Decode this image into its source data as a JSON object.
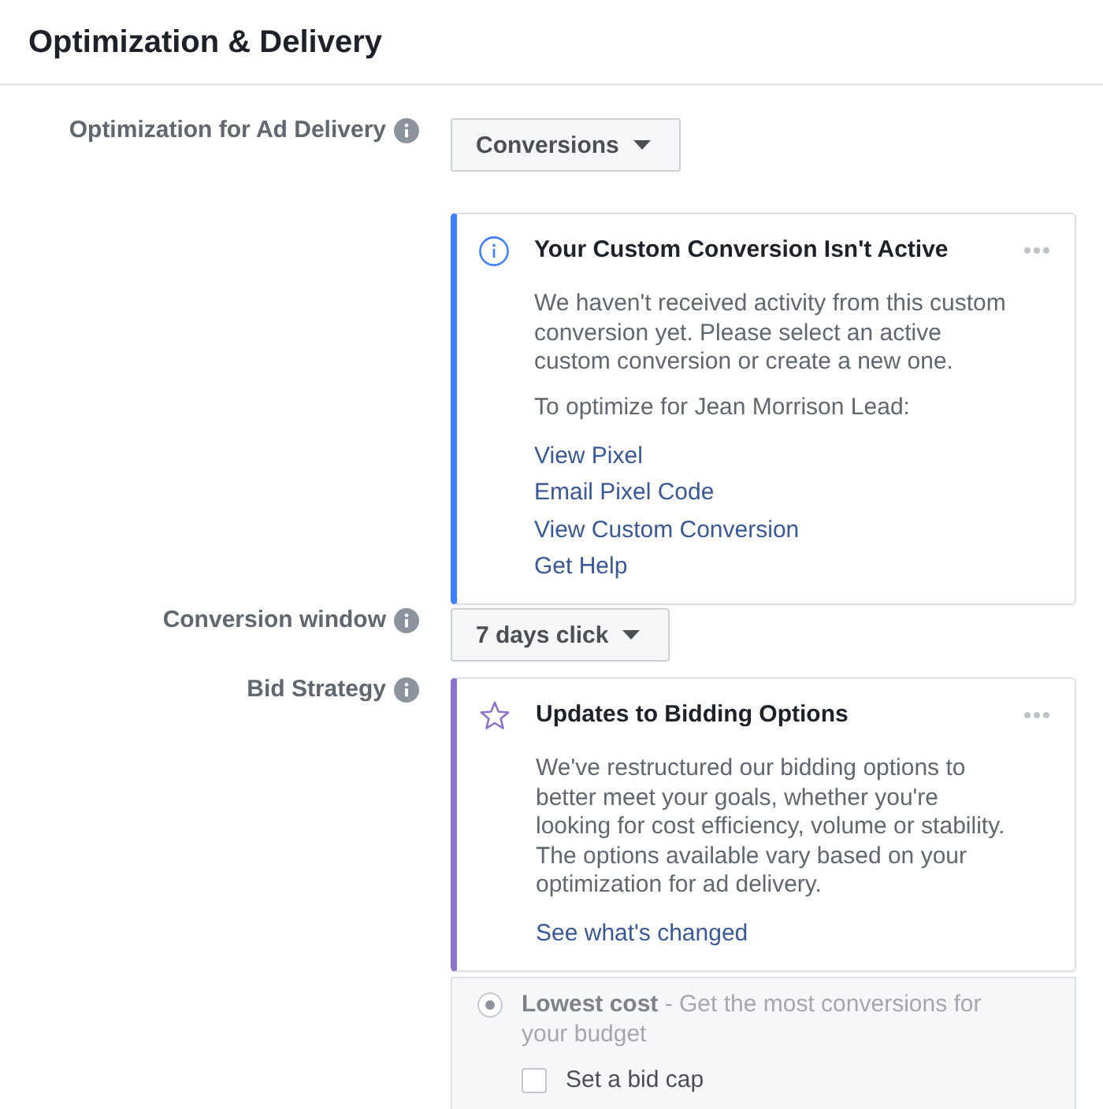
{
  "section": {
    "title": "Optimization & Delivery"
  },
  "rows": [
    {
      "label": "Optimization for Ad Delivery",
      "dropdown": {
        "value": "Conversions"
      },
      "notice": {
        "kind": "info",
        "title": "Your Custom Conversion Isn't Active",
        "paragraphs": [
          "We haven't received activity from this custom conversion yet. Please select an active custom conversion or create a new one.",
          "To optimize for Jean Morrison Lead:"
        ],
        "links": [
          "View Pixel",
          "Email Pixel Code",
          "View Custom Conversion",
          "Get Help"
        ]
      }
    },
    {
      "label": "Conversion window",
      "dropdown": {
        "value": "7 days click"
      }
    },
    {
      "label": "Bid Strategy",
      "notice": {
        "kind": "update",
        "title": "Updates to Bidding Options",
        "paragraphs": [
          "We've restructured our bidding options to better meet your goals, whether you're looking for cost efficiency, volume or stability. The options available vary based on your optimization for ad delivery."
        ],
        "links": [
          "See what's changed"
        ]
      },
      "options": [
        {
          "kind": "radio",
          "text": "**Lowest cost** - Get the most conversions for your budget",
          "selected": true,
          "children": [
            {
              "kind": "checkbox",
              "text": "Set a bid cap",
              "checked": false
            }
          ]
        }
      ]
    }
  ]
}
